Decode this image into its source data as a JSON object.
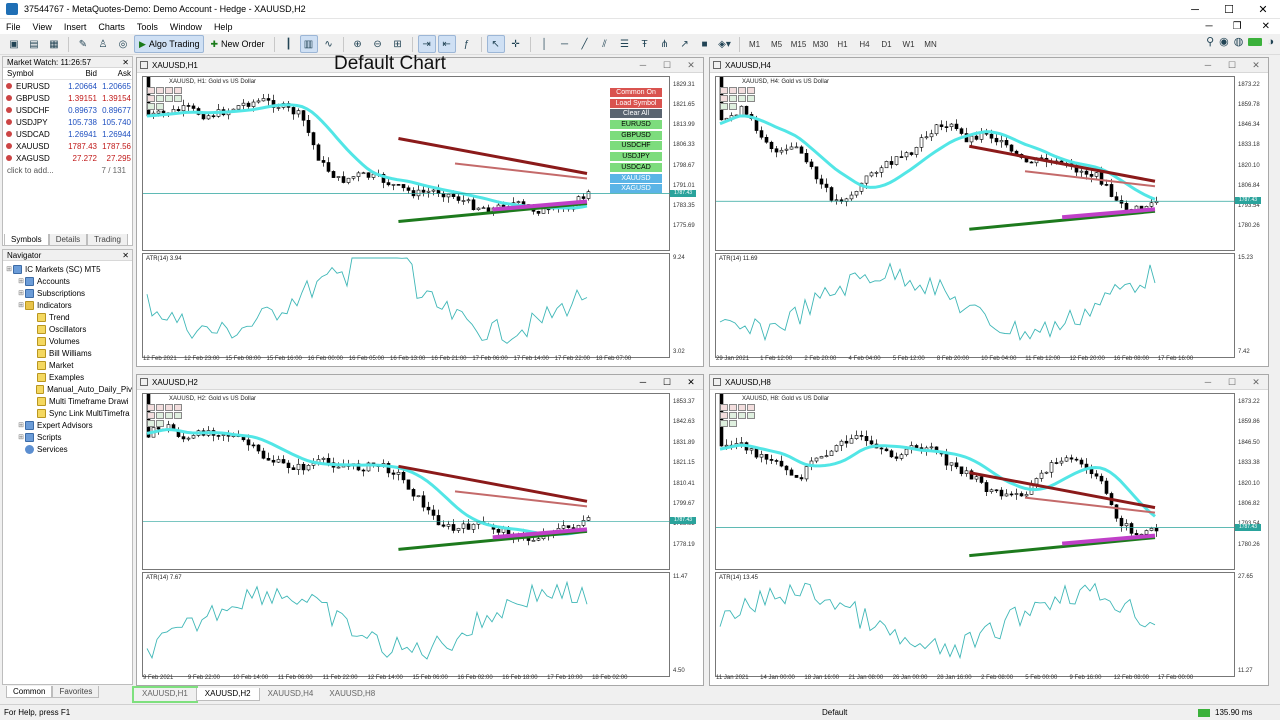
{
  "window": {
    "title": "37544767 - MetaQuotes-Demo: Demo Account - Hedge - XAUUSD,H2",
    "controls": [
      "─",
      "☐",
      "✕"
    ]
  },
  "menu": [
    "File",
    "View",
    "Insert",
    "Charts",
    "Tools",
    "Window",
    "Help"
  ],
  "toolbar": {
    "algo_label": "Algo Trading",
    "new_order_label": "New Order",
    "timeframes": [
      "M1",
      "M5",
      "M15",
      "M30",
      "H1",
      "H4",
      "D1",
      "W1",
      "MN"
    ]
  },
  "market_watch": {
    "title": "Market Watch: 11:26:57",
    "headers": [
      "Symbol",
      "Bid",
      "Ask"
    ],
    "rows": [
      {
        "symbol": "EURUSD",
        "bid": "1.20664",
        "ask": "1.20665",
        "tone": "blue"
      },
      {
        "symbol": "GBPUSD",
        "bid": "1.39151",
        "ask": "1.39154",
        "tone": "red"
      },
      {
        "symbol": "USDCHF",
        "bid": "0.89673",
        "ask": "0.89677",
        "tone": "blue"
      },
      {
        "symbol": "USDJPY",
        "bid": "105.738",
        "ask": "105.740",
        "tone": "blue"
      },
      {
        "symbol": "USDCAD",
        "bid": "1.26941",
        "ask": "1.26944",
        "tone": "blue"
      },
      {
        "symbol": "XAUUSD",
        "bid": "1787.43",
        "ask": "1787.56",
        "tone": "red"
      },
      {
        "symbol": "XAGUSD",
        "bid": "27.272",
        "ask": "27.295",
        "tone": "red"
      }
    ],
    "add_label": "click to add...",
    "count": "7 / 131",
    "tabs": [
      "Symbols",
      "Details",
      "Trading"
    ]
  },
  "navigator": {
    "title": "Navigator",
    "items": [
      {
        "label": "IC Markets (SC) MT5",
        "depth": 0,
        "icon": "blue"
      },
      {
        "label": "Accounts",
        "depth": 1,
        "icon": "blue"
      },
      {
        "label": "Subscriptions",
        "depth": 1,
        "icon": "blue"
      },
      {
        "label": "Indicators",
        "depth": 1,
        "icon": "fold"
      },
      {
        "label": "Trend",
        "depth": 2,
        "icon": "ind"
      },
      {
        "label": "Oscillators",
        "depth": 2,
        "icon": "ind"
      },
      {
        "label": "Volumes",
        "depth": 2,
        "icon": "ind"
      },
      {
        "label": "Bill Williams",
        "depth": 2,
        "icon": "ind"
      },
      {
        "label": "Market",
        "depth": 2,
        "icon": "ind"
      },
      {
        "label": "Examples",
        "depth": 2,
        "icon": "ind"
      },
      {
        "label": "Manual_Auto_Daily_Piv",
        "depth": 2,
        "icon": "ind"
      },
      {
        "label": "Multi Timeframe Drawi",
        "depth": 2,
        "icon": "ind"
      },
      {
        "label": "Sync Link MultiTimefra",
        "depth": 2,
        "icon": "ind"
      },
      {
        "label": "Expert Advisors",
        "depth": 1,
        "icon": "blue"
      },
      {
        "label": "Scripts",
        "depth": 1,
        "icon": "blue"
      },
      {
        "label": "Services",
        "depth": 1,
        "icon": "gear"
      }
    ],
    "tabs": [
      "Common",
      "Favorites"
    ]
  },
  "chart_tabs": [
    "XAUUSD,H1",
    "XAUUSD,H2",
    "XAUUSD,H4",
    "XAUUSD,H8"
  ],
  "status": {
    "help": "For Help, press F1",
    "profile": "Default",
    "ping": "135.90 ms"
  },
  "overlay_title": "Default Chart",
  "symbol_buttons": [
    {
      "label": "Common On",
      "color": "#d9534f"
    },
    {
      "label": "Load Symbol",
      "color": "#d9534f"
    },
    {
      "label": "Clear All",
      "color": "#5a6470"
    },
    {
      "label": "EURUSD",
      "color": "#7ddc7d"
    },
    {
      "label": "GBPUSD",
      "color": "#7ddc7d"
    },
    {
      "label": "USDCHF",
      "color": "#7ddc7d"
    },
    {
      "label": "USDJPY",
      "color": "#7ddc7d"
    },
    {
      "label": "USDCAD",
      "color": "#7ddc7d"
    },
    {
      "label": "XAUUSD",
      "color": "#5ab4e6"
    },
    {
      "label": "XAGUSD",
      "color": "#5ab4e6"
    }
  ],
  "charts": [
    {
      "title": "XAUUSD,H1",
      "inner_label": "XAUUSD, H1:  Gold vs US Dollar",
      "price_ticks": [
        "1829.31",
        "1821.65",
        "1813.99",
        "1806.33",
        "1798.67",
        "1791.01",
        "1783.35",
        "1775.69"
      ],
      "price_tag": "1787.43",
      "atr_label": "ATR(14) 3.94",
      "atr_ticks": [
        "9.24",
        "3.02"
      ],
      "time_ticks": [
        "12 Feb 2021",
        "12 Feb 23:00",
        "15 Feb 08:00",
        "15 Feb 16:00",
        "16 Feb 00:00",
        "16 Feb 05:00",
        "16 Feb 13:00",
        "16 Feb 21:00",
        "17 Feb 06:00",
        "17 Feb 14:00",
        "17 Feb 22:00",
        "18 Feb 07:00"
      ]
    },
    {
      "title": "XAUUSD,H4",
      "inner_label": "XAUUSD, H4:  Gold vs US Dollar",
      "price_ticks": [
        "1873.22",
        "1859.78",
        "1846.34",
        "1833.18",
        "1820.10",
        "1806.84",
        "1793.54",
        "1780.26"
      ],
      "price_tag": "1787.43",
      "atr_label": "ATR(14) 11.69",
      "atr_ticks": [
        "15.23",
        "7.42"
      ],
      "time_ticks": [
        "29 Jan 2021",
        "1 Feb 12:00",
        "2 Feb 20:00",
        "4 Feb 04:00",
        "5 Feb 12:00",
        "8 Feb 20:00",
        "10 Feb 04:00",
        "11 Feb 12:00",
        "12 Feb 20:00",
        "16 Feb 08:00",
        "17 Feb 16:00"
      ]
    },
    {
      "title": "XAUUSD,H2",
      "inner_label": "XAUUSD, H2:  Gold vs US Dollar",
      "price_ticks": [
        "1853.37",
        "1842.63",
        "1831.89",
        "1821.15",
        "1810.41",
        "1799.67",
        "1788.93",
        "1778.19"
      ],
      "price_tag": "1787.43",
      "atr_label": "ATR(14) 7.67",
      "atr_ticks": [
        "11.47",
        "4.50"
      ],
      "time_ticks": [
        "9 Feb 2021",
        "9 Feb 22:00",
        "10 Feb 14:00",
        "11 Feb 06:00",
        "11 Feb 22:00",
        "12 Feb 14:00",
        "15 Feb 06:00",
        "16 Feb 02:00",
        "16 Feb 18:00",
        "17 Feb 10:00",
        "18 Feb 02:00"
      ]
    },
    {
      "title": "XAUUSD,H8",
      "inner_label": "XAUUSD, H8:  Gold vs US Dollar",
      "price_ticks": [
        "1873.22",
        "1859.86",
        "1846.50",
        "1833.38",
        "1820.10",
        "1806.82",
        "1793.54",
        "1780.26"
      ],
      "price_tag": "1787.43",
      "atr_label": "ATR(14) 13.45",
      "atr_ticks": [
        "27.65",
        "11.27"
      ],
      "time_ticks": [
        "11 Jan 2021",
        "14 Jan 00:00",
        "18 Jan 16:00",
        "21 Jan 08:00",
        "26 Jan 00:00",
        "28 Jan 16:00",
        "2 Feb 08:00",
        "5 Feb 00:00",
        "9 Feb 16:00",
        "12 Feb 08:00",
        "17 Feb 00:00"
      ]
    }
  ]
}
